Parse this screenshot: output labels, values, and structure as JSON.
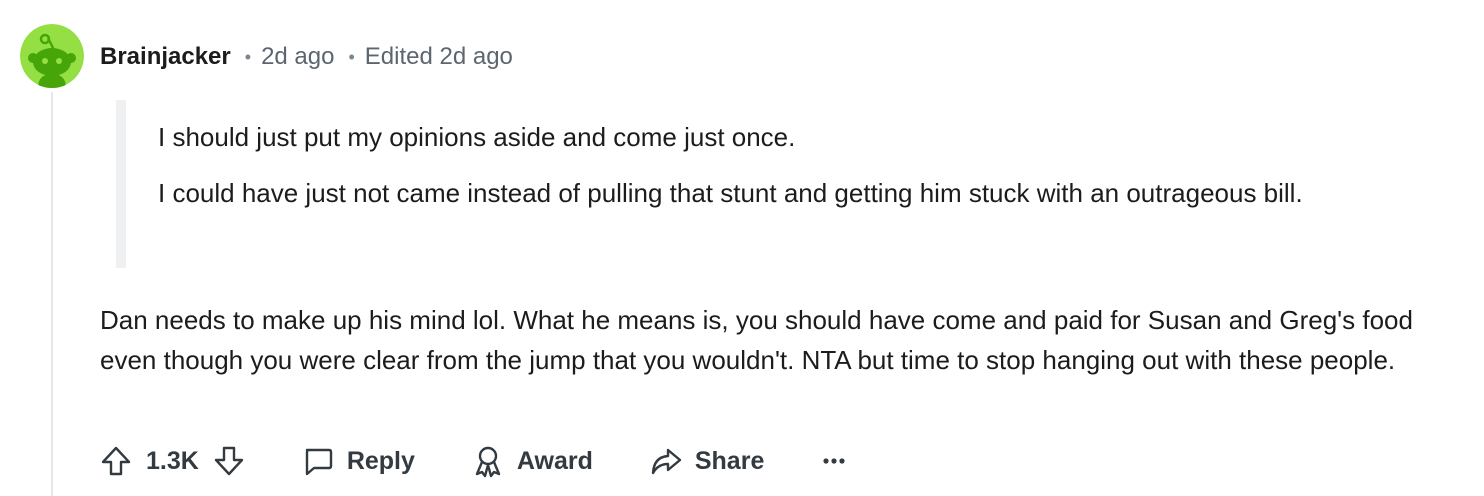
{
  "comment": {
    "author": "Brainjacker",
    "posted": "2d ago",
    "edited": "Edited 2d ago",
    "quote": [
      "I should just put my opinions aside and come just once.",
      "I could have just not came instead of pulling that stunt and getting him stuck with an outrageous bill."
    ],
    "body": "Dan needs to make up his mind lol. What he means is, you should have come and paid for Susan and Greg's food even though you were clear from the jump that you wouldn't. NTA but time to stop hanging out with these people.",
    "score": "1.3K",
    "separator": "•"
  },
  "actions": {
    "reply": "Reply",
    "award": "Award",
    "share": "Share",
    "more": "..."
  },
  "colors": {
    "avatar_bg": "#94e044",
    "avatar_figure": "#46a508",
    "thread_line": "#e5e7eb",
    "quote_bar": "#eef0f2",
    "meta_text": "#5c6670"
  },
  "icons": [
    "snoo-avatar",
    "upvote-icon",
    "downvote-icon",
    "comment-icon",
    "award-icon",
    "share-icon",
    "more-icon"
  ]
}
